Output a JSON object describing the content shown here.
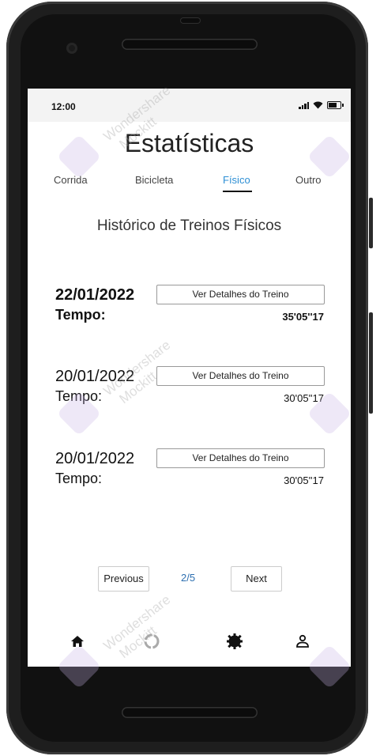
{
  "status_bar": {
    "time": "12:00"
  },
  "header": {
    "title": "Estatísticas"
  },
  "tabs": [
    {
      "label": "Corrida"
    },
    {
      "label": "Bicicleta"
    },
    {
      "label": "Físico"
    },
    {
      "label": "Outro"
    }
  ],
  "active_tab": "Físico",
  "section": {
    "title": "Histórico de Treinos Físicos"
  },
  "entries": [
    {
      "date": "22/01/2022",
      "time_label": "Tempo:",
      "button_label": "Ver Detalhes do Treino",
      "time_value": "35'05''17"
    },
    {
      "date": "20/01/2022",
      "time_label": "Tempo:",
      "button_label": "Ver Detalhes do Treino",
      "time_value": "30'05''17"
    },
    {
      "date": "20/01/2022",
      "time_label": "Tempo:",
      "button_label": "Ver Detalhes do Treino",
      "time_value": "30'05''17"
    }
  ],
  "pagination": {
    "previous_label": "Previous",
    "page_indicator": "2/5",
    "next_label": "Next"
  },
  "bottom_nav": {
    "icons": [
      "home-icon",
      "loading-icon",
      "gear-icon",
      "profile-icon"
    ]
  },
  "watermark": {
    "line1": "Wondershare",
    "line2": "Mockitt"
  },
  "colors": {
    "accent": "#2d8fd5",
    "status_bg": "#f3f3f3"
  }
}
